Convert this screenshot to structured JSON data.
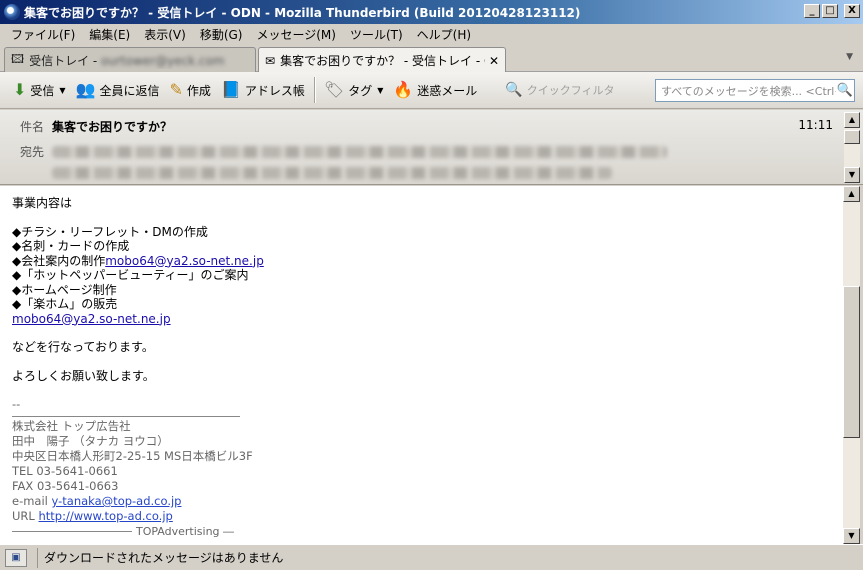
{
  "window": {
    "title": "集客でお困りですか？ - 受信トレイ - ODN - Mozilla Thunderbird (Build 20120428123112)",
    "btn_minimize": "_",
    "btn_maximize": "□",
    "btn_close": "X"
  },
  "menu": [
    "ファイル(F)",
    "編集(E)",
    "表示(V)",
    "移動(G)",
    "メッセージ(M)",
    "ツール(T)",
    "ヘルプ(H)"
  ],
  "tabs": {
    "inbox_label": "受信トレイ - ",
    "inbox_account_blurred": "ourtower@yeck.com",
    "message_label": "集客でお困りですか？ - 受信トレイ - OD...",
    "close_glyph": "✕",
    "overflow_glyph": "▼"
  },
  "toolbar": {
    "get_mail": "受信",
    "reply_all": "全員に返信",
    "write": "作成",
    "address_book": "アドレス帳",
    "tag": "タグ",
    "junk": "迷惑メール",
    "quick_filter": "クイックフィルタ",
    "search_placeholder": "すべてのメッセージを検索... <Ctrl+K>"
  },
  "header": {
    "subject_label": "件名",
    "subject": "集客でお困りですか？",
    "time": "11:11",
    "to_label": "宛先"
  },
  "body": {
    "intro": "事業内容は",
    "bullets": [
      "◆チラシ・リーフレット・DMの作成",
      "◆名刺・カードの作成"
    ],
    "company_item_prefix": "◆会社案内の制作",
    "company_item_email": "mobo64@ya2.so-net.ne.jp",
    "bullets2": [
      "◆「ホットペッパービューティー」のご案内",
      "◆ホームページ制作",
      "◆「楽ホム」の販売"
    ],
    "email_line": "mobo64@ya2.so-net.ne.jp",
    "closing1": "などを行なっております。",
    "closing2": "よろしくお願い致します。",
    "sig_dash": "--",
    "sig_company": "株式会社 トップ広告社",
    "sig_name": "田中　陽子 （タナカ ヨウコ）",
    "sig_address": "中央区日本橋人形町2-25-15 MS日本橋ビル3F",
    "sig_tel": "TEL  03-5641-0661",
    "sig_fax": "FAX  03-5641-0663",
    "sig_email_label": "e-mail ",
    "sig_email": "y-tanaka@top-ad.co.jp",
    "sig_url_label": "URL ",
    "sig_url": "http://www.top-ad.co.jp",
    "sig_footer": "TOPAdvertising ―"
  },
  "status": {
    "text": "ダウンロードされたメッセージはありません"
  }
}
